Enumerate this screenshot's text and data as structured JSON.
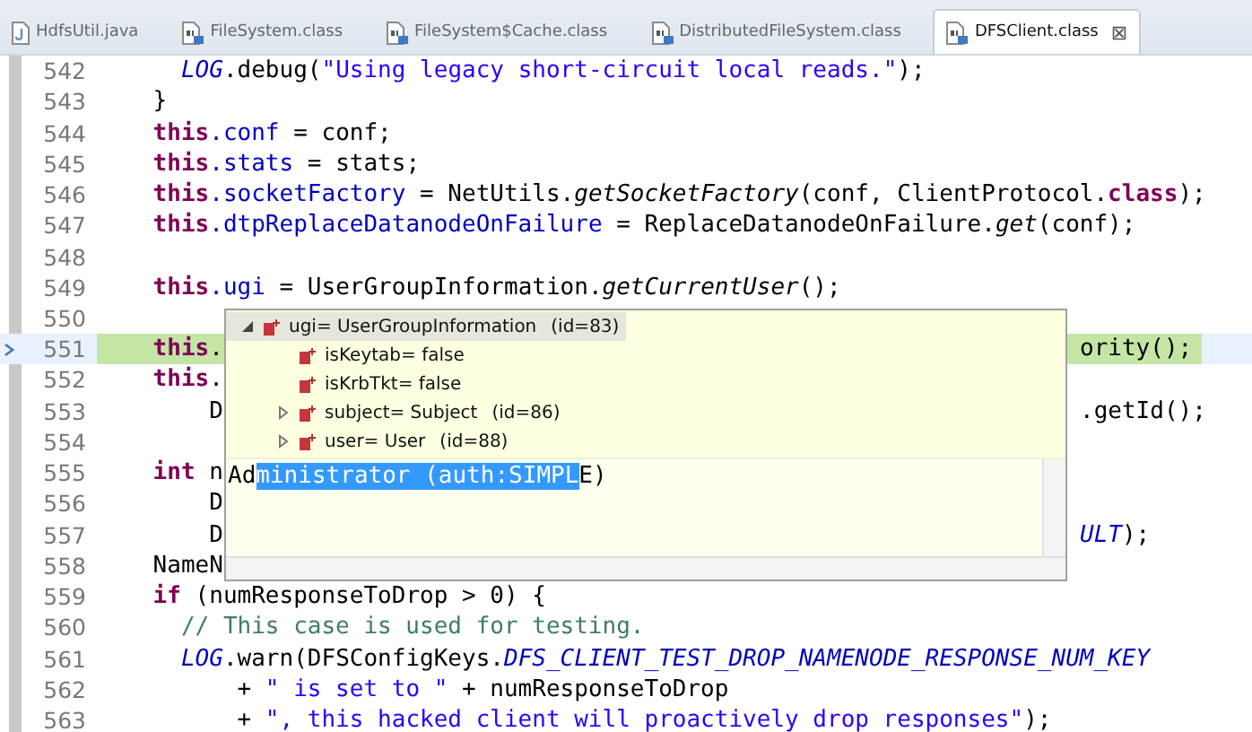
{
  "tabs": [
    {
      "label": "HdfsUtil.java",
      "kind": "java",
      "selected": false
    },
    {
      "label": "FileSystem.class",
      "kind": "class",
      "selected": false
    },
    {
      "label": "FileSystem$Cache.class",
      "kind": "class",
      "selected": false
    },
    {
      "label": "DistributedFileSystem.class",
      "kind": "class",
      "selected": false
    },
    {
      "label": "DFSClient.class",
      "kind": "class",
      "selected": true,
      "close": "⊠"
    }
  ],
  "lines": [
    {
      "number": "542",
      "current": false,
      "tokens": [
        {
          "kind": "static",
          "text": "      LOG"
        },
        {
          "kind": "plain",
          "text": ".debug("
        },
        {
          "kind": "string",
          "text": "\"Using legacy short-circuit local reads.\""
        },
        {
          "kind": "plain",
          "text": ");"
        }
      ]
    },
    {
      "number": "543",
      "current": false,
      "tokens": [
        {
          "kind": "plain",
          "text": "    }"
        }
      ]
    },
    {
      "number": "544",
      "current": false,
      "tokens": [
        {
          "kind": "keyword",
          "text": "    this"
        },
        {
          "kind": "field",
          "text": ".conf"
        },
        {
          "kind": "plain",
          "text": " = conf;"
        }
      ]
    },
    {
      "number": "545",
      "current": false,
      "tokens": [
        {
          "kind": "keyword",
          "text": "    this"
        },
        {
          "kind": "field",
          "text": ".stats"
        },
        {
          "kind": "plain",
          "text": " = stats;"
        }
      ]
    },
    {
      "number": "546",
      "current": false,
      "tokens": [
        {
          "kind": "keyword",
          "text": "    this"
        },
        {
          "kind": "field",
          "text": ".socketFactory"
        },
        {
          "kind": "plain",
          "text": " = NetUtils."
        },
        {
          "kind": "method",
          "text": "getSocketFactory"
        },
        {
          "kind": "plain",
          "text": "(conf, ClientProtocol."
        },
        {
          "kind": "keyword",
          "text": "class"
        },
        {
          "kind": "plain",
          "text": ");"
        }
      ]
    },
    {
      "number": "547",
      "current": false,
      "tokens": [
        {
          "kind": "keyword",
          "text": "    this"
        },
        {
          "kind": "field",
          "text": ".dtpReplaceDatanodeOnFailure"
        },
        {
          "kind": "plain",
          "text": " = ReplaceDatanodeOnFailure."
        },
        {
          "kind": "method",
          "text": "get"
        },
        {
          "kind": "plain",
          "text": "(conf);"
        }
      ]
    },
    {
      "number": "548",
      "current": false
    },
    {
      "number": "549",
      "current": false,
      "tokens": [
        {
          "kind": "keyword",
          "text": "    this"
        },
        {
          "kind": "field",
          "text": ".ugi"
        },
        {
          "kind": "plain",
          "text": " = UserGroupInformation."
        },
        {
          "kind": "method",
          "text": "getCurrentUser"
        },
        {
          "kind": "plain",
          "text": "();"
        }
      ]
    },
    {
      "number": "550",
      "current": false
    },
    {
      "number": "551",
      "current": true,
      "tokens": [
        {
          "kind": "keyword",
          "text": "    this"
        },
        {
          "kind": "plain",
          "text": "."
        }
      ],
      "tail": [
        {
          "kind": "plain",
          "text": "ority();"
        }
      ]
    },
    {
      "number": "552",
      "current": false,
      "tokens": [
        {
          "kind": "keyword",
          "text": "    this"
        },
        {
          "kind": "plain",
          "text": "."
        }
      ]
    },
    {
      "number": "553",
      "current": false,
      "tokens": [
        {
          "kind": "plain",
          "text": "        D"
        }
      ],
      "tail": [
        {
          "kind": "plain",
          "text": ".getId();"
        }
      ]
    },
    {
      "number": "554",
      "current": false
    },
    {
      "number": "555",
      "current": false,
      "tokens": [
        {
          "kind": "keyword",
          "text": "    int"
        },
        {
          "kind": "plain",
          "text": " n"
        }
      ]
    },
    {
      "number": "556",
      "current": false,
      "tokens": [
        {
          "kind": "plain",
          "text": "        D"
        }
      ]
    },
    {
      "number": "557",
      "current": false,
      "tokens": [
        {
          "kind": "plain",
          "text": "        D"
        }
      ],
      "tail": [
        {
          "kind": "static",
          "text": "ULT"
        },
        {
          "kind": "plain",
          "text": ");"
        }
      ]
    },
    {
      "number": "558",
      "current": false,
      "tokens": [
        {
          "kind": "plain",
          "text": "    NameN"
        }
      ]
    },
    {
      "number": "559",
      "current": false,
      "tokens": [
        {
          "kind": "keyword",
          "text": "    if"
        },
        {
          "kind": "plain",
          "text": " (numResponseToDrop > 0) {"
        }
      ]
    },
    {
      "number": "560",
      "current": false,
      "tokens": [
        {
          "kind": "comment",
          "text": "      // This case is used for testing."
        }
      ]
    },
    {
      "number": "561",
      "current": false,
      "tokens": [
        {
          "kind": "static",
          "text": "      LOG"
        },
        {
          "kind": "plain",
          "text": ".warn(DFSConfigKeys."
        },
        {
          "kind": "static",
          "text": "DFS_CLIENT_TEST_DROP_NAMENODE_RESPONSE_NUM_KEY"
        }
      ]
    },
    {
      "number": "562",
      "current": false,
      "tokens": [
        {
          "kind": "plain",
          "text": "          + "
        },
        {
          "kind": "string",
          "text": "\" is set to \""
        },
        {
          "kind": "plain",
          "text": " + numResponseToDrop"
        }
      ]
    },
    {
      "number": "563",
      "current": false,
      "tokens": [
        {
          "kind": "plain",
          "text": "          + "
        },
        {
          "kind": "string",
          "text": "\", this hacked client will proactively drop responses\""
        },
        {
          "kind": "plain",
          "text": ");"
        }
      ]
    }
  ],
  "inspector": {
    "tree": [
      {
        "label": "ugi= UserGroupInformation",
        "detail": "(id=83)",
        "expanded": true,
        "selected": true,
        "children": [
          {
            "label": "isKeytab= false",
            "selected": false
          },
          {
            "label": "isKrbTkt= false",
            "selected": false
          },
          {
            "label": "subject= Subject",
            "detail": "(id=86)",
            "expanded": false,
            "selected": false
          },
          {
            "label": "user= User",
            "detail": "(id=88)",
            "expanded": false,
            "selected": false
          }
        ]
      }
    ],
    "value": [
      {
        "text": "Ad",
        "selected": false
      },
      {
        "text": "ministrator (auth:SIMPL",
        "selected": true
      },
      {
        "text": "E)",
        "selected": false
      }
    ]
  }
}
